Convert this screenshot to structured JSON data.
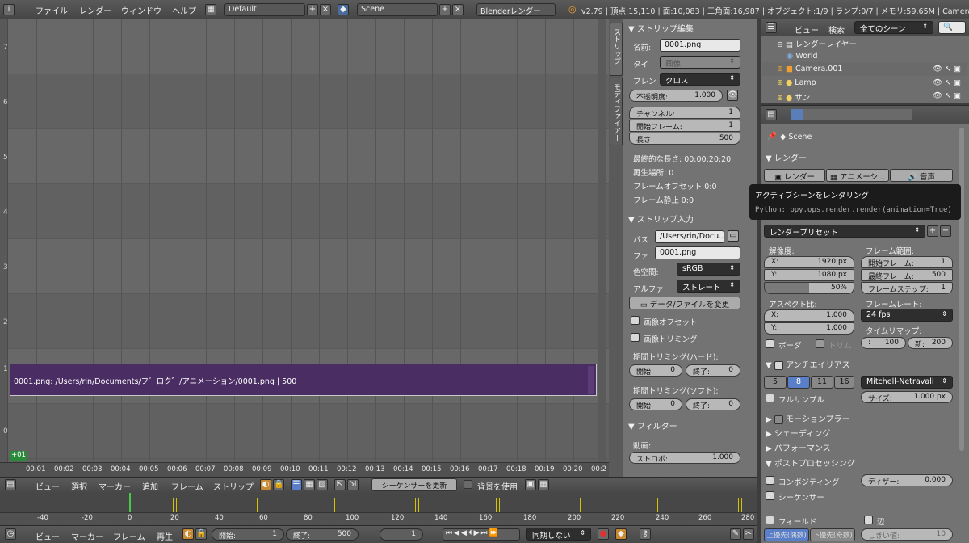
{
  "topbar": {
    "menus": [
      "ファイル",
      "レンダー",
      "ウィンドウ",
      "ヘルプ"
    ],
    "layout": "Default",
    "scene": "Scene",
    "engine": "Blenderレンダー",
    "stats": "v2.79 | 頂点:15,110 | 面:10,083 | 三角面:16,987 | オブジェクト:1/9 | ランプ:0/7 | メモリ:59.65M | Camera.0"
  },
  "sequencer": {
    "channels": [
      "7",
      "6",
      "5",
      "4",
      "3",
      "2",
      "1",
      "0"
    ],
    "strip_label": "0001.png: /Users/rin/Documents/フ゛ロク゛/アニメーション/0001.png | 500",
    "frame_badge": "+01",
    "ruler_ticks": [
      "00:01",
      "00:02",
      "00:03",
      "00:04",
      "00:05",
      "00:06",
      "00:07",
      "00:08",
      "00:09",
      "00:10",
      "00:11",
      "00:12",
      "00:13",
      "00:14",
      "00:15",
      "00:16",
      "00:17",
      "00:18",
      "00:19",
      "00:20",
      "00:2"
    ]
  },
  "strip_panel": {
    "tabs": [
      "ストリップ",
      "モディファイアー"
    ],
    "edit_header": "ストリップ編集",
    "name_label": "名前:",
    "name_value": "0001.png",
    "type_label": "タイ",
    "type_value": "画像",
    "blend_label": "ブレン",
    "blend_value": "クロス",
    "opacity_label": "不透明度:",
    "opacity_value": "1.000",
    "channel_label": "チャンネル:",
    "channel_value": "1",
    "start_label": "開始フレーム:",
    "start_value": "1",
    "length_label": "長さ:",
    "length_value": "500",
    "final_length": "最終的な長さ: 00:00:20:20",
    "playhead": "再生場所: 0",
    "frame_offset": "フレームオフセット 0:0",
    "frame_still": "フレーム静止 0:0",
    "input_header": "ストリップ入力",
    "path_label": "パス",
    "path_value": "/Users/rin/Docu...",
    "file_label": "ファ",
    "file_value": "0001.png",
    "colorspace_label": "色空間:",
    "colorspace_value": "sRGB",
    "alpha_label": "アルファ:",
    "alpha_value": "ストレート",
    "change_button": "データ/ファイルを変更",
    "image_offset": "画像オフセット",
    "image_crop": "画像トリミング",
    "hard_trim": "期間トリミング(ハード):",
    "soft_trim": "期間トリミング(ソフト):",
    "trim_start_label": "開始:",
    "trim_start_value": "0",
    "trim_end_label": "終了:",
    "trim_end_value": "0",
    "filter_header": "フィルター",
    "video_label": "動画:",
    "strobe_label": "ストロボ:",
    "strobe_value": "1.000"
  },
  "outliner": {
    "view": "ビュー",
    "search": "検索",
    "scenes": "全てのシーン",
    "items": [
      "レンダーレイヤー",
      "World",
      "Camera.001",
      "Lamp",
      "サン"
    ]
  },
  "render_props": {
    "scene": "Scene",
    "render_header": "レンダー",
    "render_btn": "レンダー",
    "anim_btn": "アニメーシ...",
    "audio_btn": "音声",
    "display_partial": "ディスプ...",
    "preset": "レンダープリセット",
    "resolution_label": "解像度:",
    "res_x_label": "X:",
    "res_x": "1920 px",
    "res_y_label": "Y:",
    "res_y": "1080 px",
    "res_pct": "50%",
    "res_pct_fraction": 0.5,
    "frame_range_label": "フレーム範囲:",
    "frame_start_label": "開始フレーム:",
    "frame_start": "1",
    "frame_end_label": "最終フレーム:",
    "frame_end": "500",
    "frame_step_label": "フレームステップ:",
    "frame_step": "1",
    "aspect_label": "アスペクト比:",
    "aspect_x": "1.000",
    "aspect_y": "1.000",
    "framerate_label": "フレームレート:",
    "fps": "24 fps",
    "border": "ボーダ",
    "crop": "トリム",
    "time_remap": "タイムリマップ:",
    "remap_old_label": ":",
    "remap_old": "100",
    "remap_new_label": "新:",
    "remap_new": "200",
    "aa_header": "アンチエイリアス",
    "aa_samples": [
      "5",
      "8",
      "11",
      "16"
    ],
    "aa_filter": "Mitchell-Netravali",
    "full_sample": "フルサンプル",
    "size_label": "サイズ:",
    "size_value": "1.000 px",
    "motion_blur": "モーションブラー",
    "shading": "シェーディング",
    "performance": "パフォーマンス",
    "post_header": "ポストプロセッシング",
    "compositing": "コンポジティング",
    "dither_label": "ディザー:",
    "dither_value": "0.000",
    "sequencer": "シーケンサー",
    "fields": "フィールド",
    "edge": "辺",
    "upper_first": "上優先(偶数)",
    "lower_first": "下優先(奇数)",
    "threshold": "しきい値:",
    "threshold_value": "10"
  },
  "tooltip": {
    "title": "アクティブシーンをレンダリング.",
    "python": "Python: bpy.ops.render.render(animation=True)"
  },
  "seq_header": {
    "menus": [
      "ビュー",
      "選択",
      "マーカー",
      "追加",
      "フレーム",
      "ストリップ"
    ],
    "refresh": "シーケンサーを更新",
    "use_bg": "背景を使用"
  },
  "timeline": {
    "ticks": [
      "-40",
      "-20",
      "0",
      "20",
      "40",
      "60",
      "80",
      "100",
      "120",
      "140",
      "160",
      "180",
      "200",
      "220",
      "240",
      "260",
      "280"
    ]
  },
  "bottom": {
    "menus": [
      "ビュー",
      "マーカー",
      "フレーム",
      "再生"
    ],
    "start_label": "開始:",
    "start": "1",
    "end_label": "終了:",
    "end": "500",
    "current": "1",
    "sync": "同期しない"
  }
}
